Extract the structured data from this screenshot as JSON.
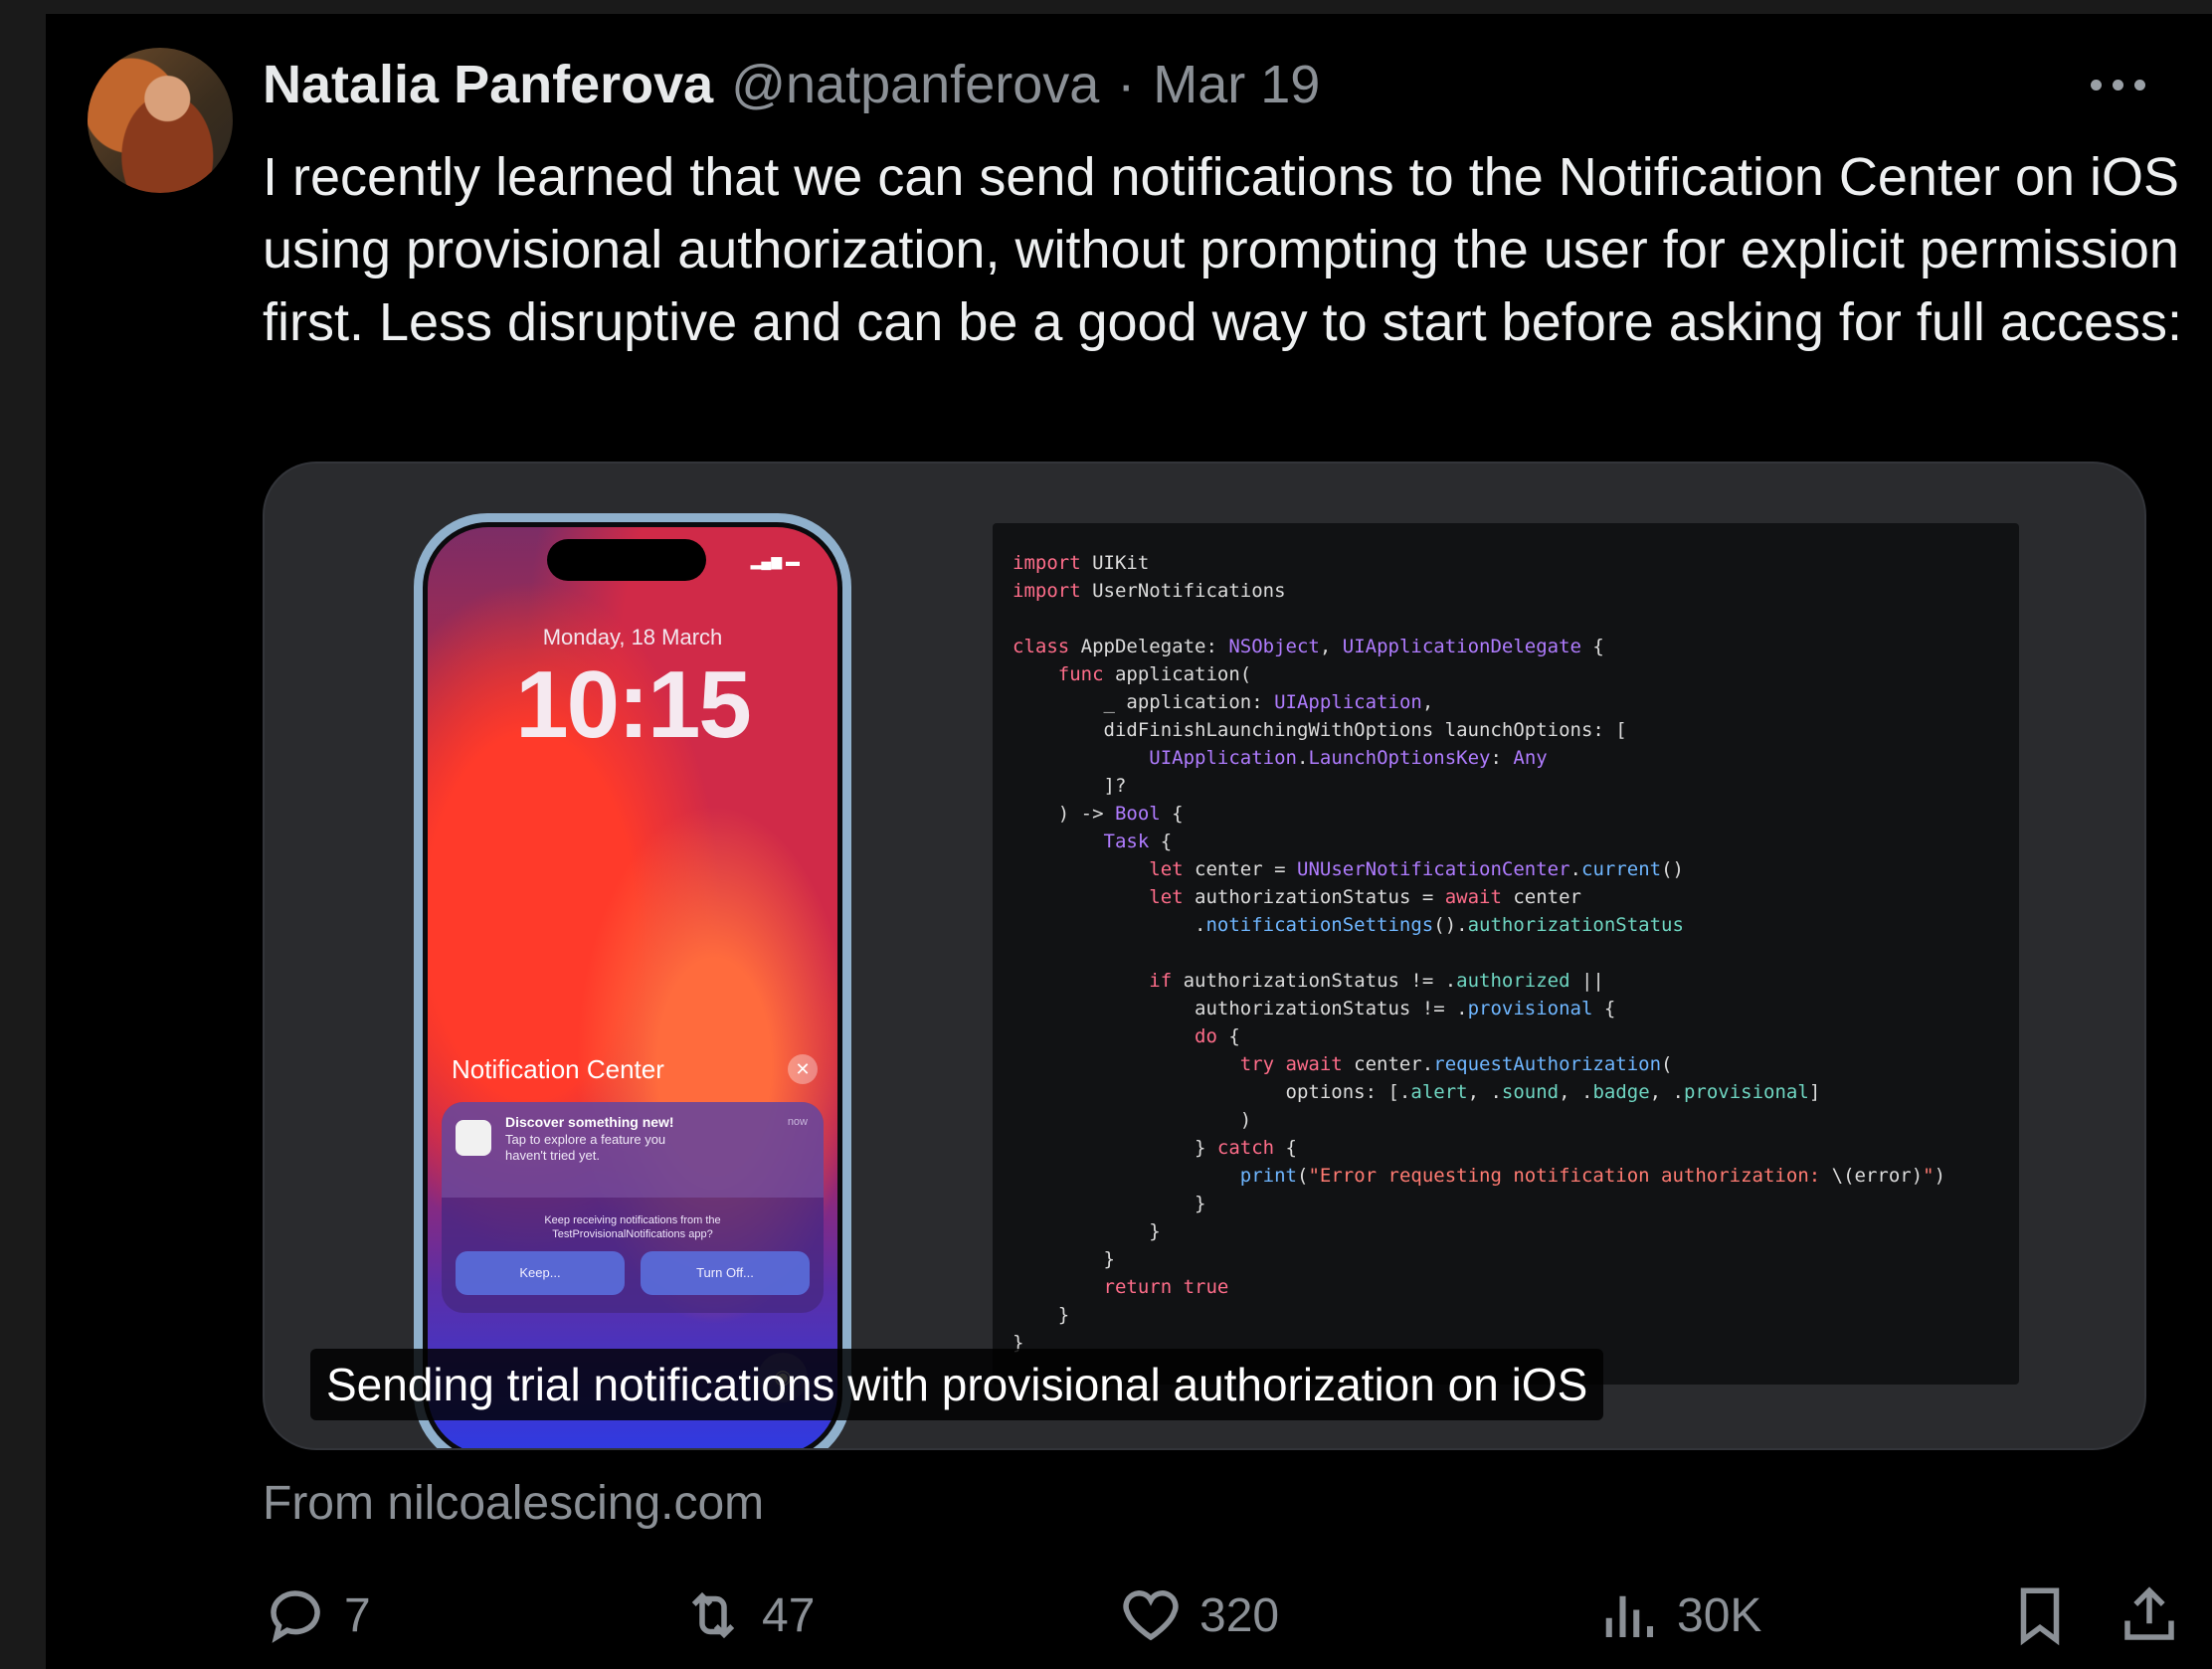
{
  "author": {
    "name": "Natalia Panferova",
    "handle": "@natpanferova",
    "separator": "·",
    "date": "Mar 19"
  },
  "tweet_text": "I recently learned that we can send notifications to the Notification Center on iOS using provisional authorization, without prompting the user for explicit permission first. Less disruptive and can be a good way to start before asking for full access:",
  "card": {
    "caption": "Sending trial notifications with provisional authorization on iOS",
    "source": "From nilcoalescing.com",
    "phone": {
      "date": "Monday, 18 March",
      "time": "10:15",
      "notification_center_title": "Notification Center",
      "notification_title": "Discover something new!",
      "notification_body": "Tap to explore a feature you haven't tried yet.",
      "notification_time": "now",
      "notification_prompt": "Keep receiving notifications from the TestProvisionalNotifications app?",
      "keep_label": "Keep...",
      "turn_off_label": "Turn Off..."
    }
  },
  "actions": {
    "replies": "7",
    "retweets": "47",
    "likes": "320",
    "views": "30K"
  },
  "icons": [
    "more-icon",
    "reply-icon",
    "retweet-icon",
    "like-icon",
    "views-icon",
    "bookmark-icon",
    "share-icon"
  ]
}
